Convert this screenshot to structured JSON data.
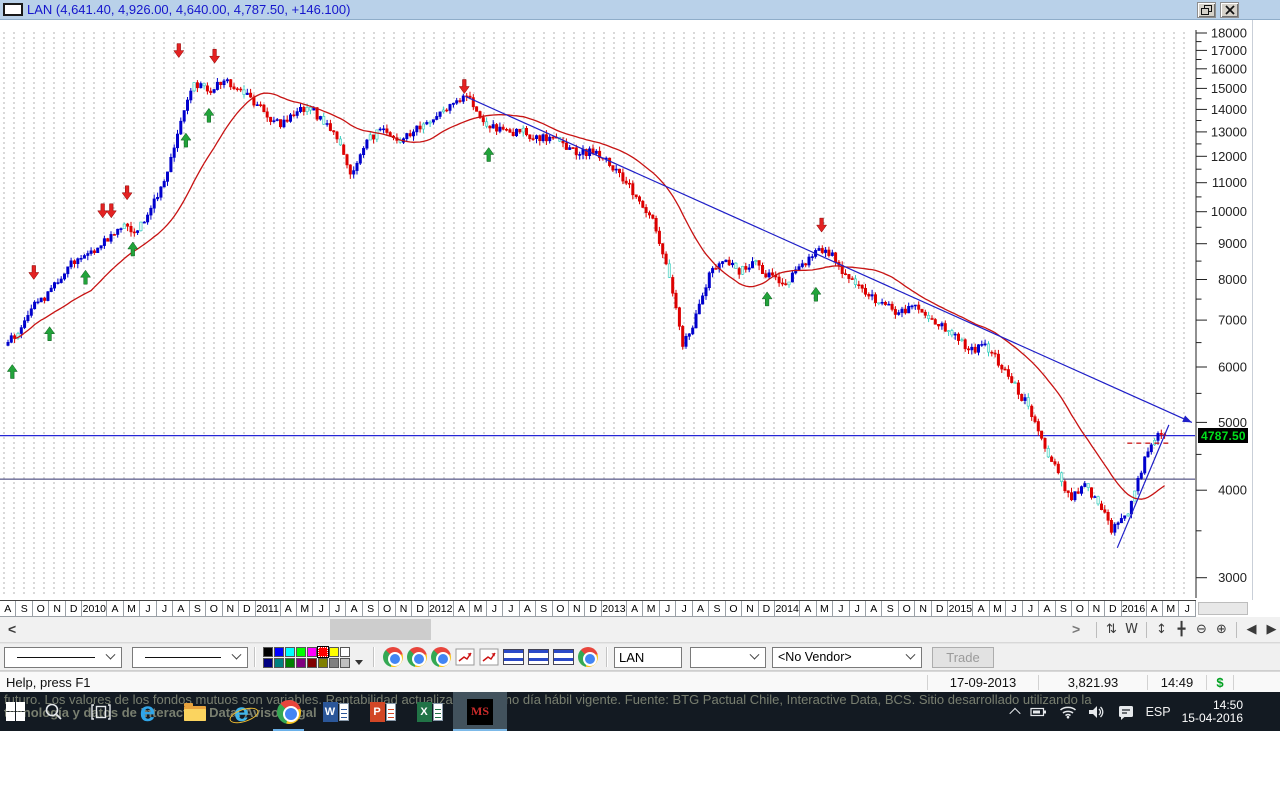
{
  "titlebar": {
    "title": "LAN (4,641.40, 4,926.00, 4,640.00, 4,787.50, +146.100)"
  },
  "chart": {
    "price_label": "4787.50",
    "y_ticks": [
      18000,
      17000,
      16000,
      15000,
      14000,
      13000,
      12000,
      11000,
      10000,
      9000,
      8000,
      7000,
      6000,
      5000,
      4000,
      3000
    ],
    "x_labels": [
      "A",
      "S",
      "O",
      "N",
      "D",
      "2010",
      "A",
      "M",
      "J",
      "J",
      "A",
      "S",
      "O",
      "N",
      "D",
      "2011",
      "A",
      "M",
      "J",
      "J",
      "A",
      "S",
      "O",
      "N",
      "D",
      "2012",
      "A",
      "M",
      "J",
      "J",
      "A",
      "S",
      "O",
      "N",
      "D",
      "2013",
      "A",
      "M",
      "J",
      "J",
      "A",
      "S",
      "O",
      "N",
      "D",
      "2014",
      "A",
      "M",
      "J",
      "J",
      "A",
      "S",
      "O",
      "N",
      "D",
      "2015",
      "A",
      "M",
      "J",
      "J",
      "A",
      "S",
      "O",
      "N",
      "D",
      "2016",
      "A",
      "M",
      "J"
    ],
    "colors": {
      "up": "#0000cc",
      "down": "#dd0000",
      "alt_stroke": "#35cdbf",
      "alt_fill": "#dff8f2",
      "ma": "#c81414",
      "grid": "#b3b3b3",
      "axis": "#222222",
      "trend": "#1f1fc8",
      "hline_current": "#2626d4",
      "hline_support": "#30306e",
      "dashed_level": "#cc2222",
      "sell_arrow": "#e32222",
      "buy_arrow": "#22a33a",
      "price_label_bg": "#000000",
      "price_label_text": "#00e01c"
    }
  },
  "chart_data": {
    "type": "candlestick",
    "symbol": "LAN",
    "timeframe": "weekly",
    "y_scale": "log",
    "ylim": [
      2800,
      18500
    ],
    "x_range": [
      "2009-08",
      "2016-04"
    ],
    "title": "LAN (4,641.40, 4,926.00, 4,640.00, 4,787.50, +146.100)",
    "last_ohlc": {
      "open": 4641.4,
      "high": 4926.0,
      "low": 4640.0,
      "close": 4787.5,
      "change": "+146.100"
    },
    "monthly_closes": {
      "start": "2009-08",
      "interval": "1M",
      "values": [
        6500,
        6900,
        7400,
        7700,
        8300,
        8600,
        8800,
        9200,
        9500,
        9400,
        10100,
        11300,
        13200,
        15300,
        14800,
        15400,
        15000,
        14500,
        13700,
        13300,
        13900,
        14100,
        13400,
        12700,
        11200,
        12600,
        13100,
        12500,
        13000,
        13200,
        13700,
        14300,
        14700,
        13300,
        13100,
        12900,
        13000,
        12700,
        12900,
        12300,
        12100,
        12200,
        11700,
        11100,
        10400,
        9600,
        8300,
        6400,
        7100,
        8300,
        8600,
        8200,
        8500,
        8100,
        7900,
        8200,
        8700,
        8900,
        8300,
        7900,
        7600,
        7400,
        7100,
        7400,
        7000,
        6900,
        6700,
        6300,
        6500,
        6100,
        5700,
        5300,
        4700,
        4300,
        3900,
        4100,
        3800,
        3500,
        3700,
        4300,
        4787.5
      ]
    },
    "moving_average": {
      "period": 26
    },
    "horizontal_lines": [
      {
        "price": 4787.5
      },
      {
        "price": 4150
      }
    ],
    "trendlines": [
      {
        "from": {
          "month_index": 31.9,
          "price": 14600
        },
        "to": {
          "month_index": 82.5,
          "price": 5000
        },
        "arrowhead": true
      },
      {
        "from": {
          "month_index": 77.3,
          "price": 3310
        },
        "to": {
          "month_index": 80.9,
          "price": 4960
        },
        "arrowhead": false
      }
    ],
    "dashed_level": {
      "price": 4670,
      "from_month": 78.0,
      "to_month": 81.0
    },
    "signals": {
      "sell": [
        {
          "month": 1.8,
          "price": 8000
        },
        {
          "month": 6.6,
          "price": 9800
        },
        {
          "month": 7.2,
          "price": 9800
        },
        {
          "month": 8.3,
          "price": 10400
        },
        {
          "month": 11.9,
          "price": 16600
        },
        {
          "month": 14.4,
          "price": 16300
        },
        {
          "month": 31.8,
          "price": 14750
        },
        {
          "month": 56.7,
          "price": 9350
        }
      ],
      "buy": [
        {
          "month": 0.3,
          "price": 6050
        },
        {
          "month": 2.9,
          "price": 6850
        },
        {
          "month": 5.4,
          "price": 8250
        },
        {
          "month": 8.7,
          "price": 9050
        },
        {
          "month": 12.4,
          "price": 12950
        },
        {
          "month": 14.0,
          "price": 14050
        },
        {
          "month": 33.5,
          "price": 12350
        },
        {
          "month": 52.9,
          "price": 7680
        },
        {
          "month": 56.3,
          "price": 7800
        }
      ]
    }
  },
  "scrollbar": {
    "left_arrow": "<",
    "right_arrow": ">",
    "icons": [
      {
        "name": "refresh-icon",
        "glyph": "⇅"
      },
      {
        "name": "weekly-periodicity-icon",
        "glyph": "W"
      },
      {
        "name": "vertical-scale-icon",
        "glyph": "↕"
      },
      {
        "name": "pan-icon",
        "glyph": "╋"
      },
      {
        "name": "zoom-out-icon",
        "glyph": "⊖"
      },
      {
        "name": "zoom-in-icon",
        "glyph": "⊕"
      },
      {
        "name": "step-left-icon",
        "glyph": "◀"
      },
      {
        "name": "step-right-icon",
        "glyph": "▶"
      },
      {
        "name": "list-icon",
        "glyph": "≡"
      }
    ]
  },
  "toolbar": {
    "symbol_value": "LAN",
    "vendor_value": "<No Vendor>",
    "trade_label": "Trade",
    "palette": {
      "selected_index": 5,
      "colors": [
        "#000000",
        "#0000ff",
        "#00ffff",
        "#00ff00",
        "#ff00ff",
        "#ff0000",
        "#ffff00",
        "#ffffff",
        "#000080",
        "#008080",
        "#008000",
        "#800080",
        "#800000",
        "#808000",
        "#808080",
        "#c0c0c0"
      ]
    }
  },
  "statusbar": {
    "help": "Help, press F1",
    "date": "17-09-2013",
    "value": "3,821.93",
    "time": "14:49",
    "currency": "$"
  },
  "background_window": {
    "line1": "futuro. Los valores de los fondos mutuos son variables. Rentabilidad actualizada al último día hábil vigente. Fuente: BTG Pactual Chile, Interactive Data, BCS. Sitio desarrollado utilizando la",
    "line2": "tecnología y datos de Interactive Data. Aviso Legal"
  },
  "taskbar": {
    "apps": [
      "start",
      "search",
      "task-view",
      "edge",
      "file-explorer",
      "internet-explorer",
      "chrome",
      "word",
      "powerpoint",
      "excel",
      "metastock"
    ],
    "active_apps": [
      "chrome",
      "metastock"
    ],
    "letters": {
      "edge": "e",
      "ie": "e",
      "word": "W",
      "powerpoint": "P",
      "excel": "X",
      "metastock": "MS"
    },
    "tray": {
      "language": "ESP",
      "time": "14:50",
      "date": "15-04-2016"
    }
  }
}
